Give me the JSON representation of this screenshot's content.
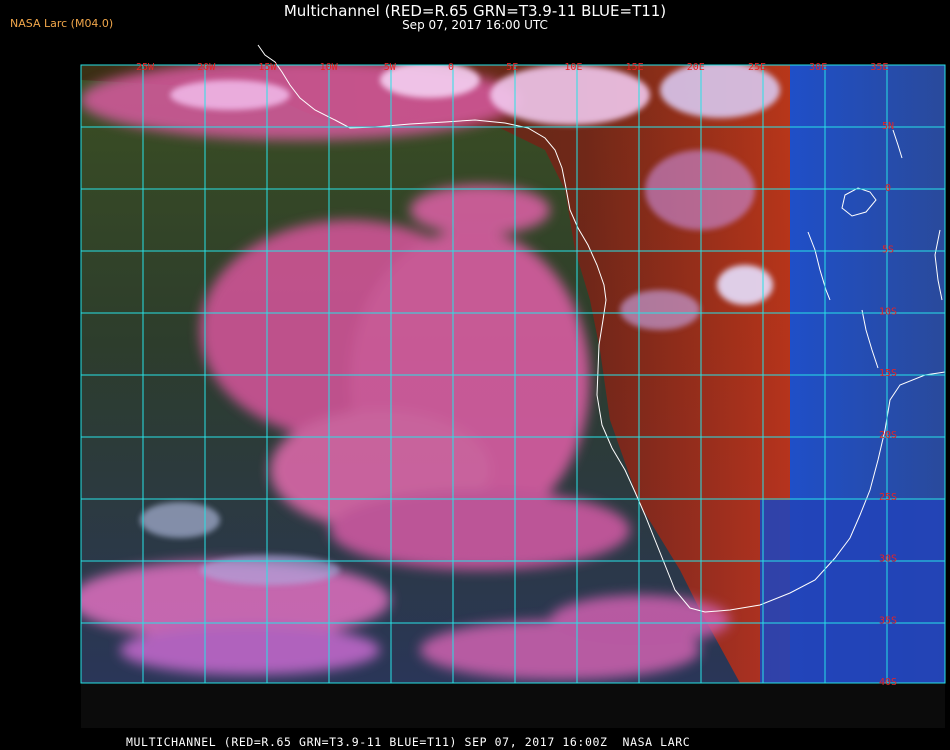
{
  "header": {
    "credit": "NASA Larc (M04.0)",
    "title": "Multichannel (RED=R.65 GRN=T3.9-11 BLUE=T11)",
    "datetime": "Sep 07, 2017 16:00 UTC"
  },
  "map": {
    "grid_color": "#27e2e6",
    "label_color": "#e52424",
    "lon_labels": [
      "25W",
      "20W",
      "15W",
      "10W",
      "5W",
      "0",
      "5E",
      "10E",
      "15E",
      "20E",
      "25E",
      "30E",
      "35E"
    ],
    "lat_labels": [
      "5N",
      "0",
      "5S",
      "10S",
      "15S",
      "20S",
      "25S",
      "30S",
      "35S",
      "40S"
    ],
    "colors": {
      "ocean_green": "#2f4a22",
      "ocean_blue": "#2b3c5a",
      "cloud_pink": "#e45aa8",
      "land_red": "#8a2a1a",
      "ir_blue": "#2a55cc",
      "coast": "#ffffff"
    }
  },
  "footer": {
    "text": "MULTICHANNEL (RED=R.65 GRN=T3.9-11 BLUE=T11) SEP 07, 2017 16:00Z  NASA LARC"
  }
}
